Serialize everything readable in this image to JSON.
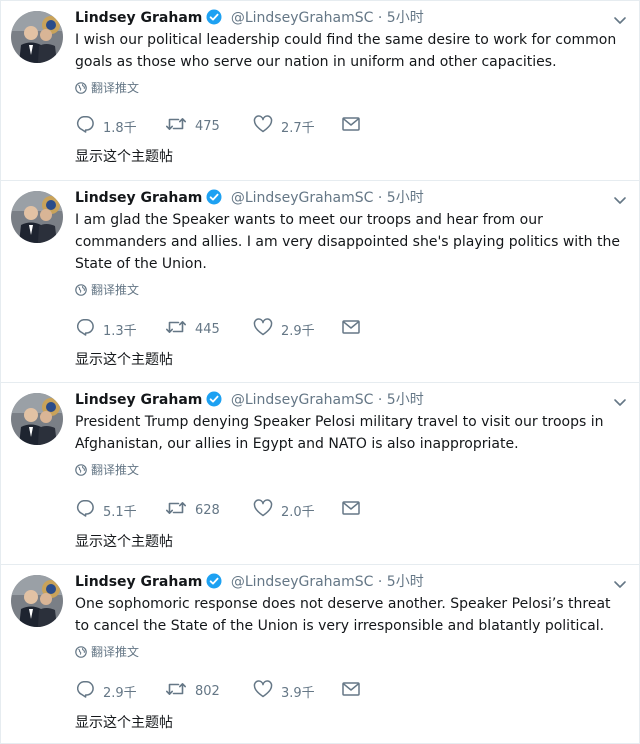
{
  "tweets": [
    {
      "name": "Lindsey Graham",
      "handle": "@LindseyGrahamSC",
      "sep": "·",
      "time": "5小时",
      "text": "I wish our political leadership could find the same desire to work for common goals as those who serve our nation in uniform and other capacities.",
      "translate": "翻译推文",
      "replies": "1.8千",
      "retweets": "475",
      "likes": "2.7千",
      "thread": "显示这个主题帖"
    },
    {
      "name": "Lindsey Graham",
      "handle": "@LindseyGrahamSC",
      "sep": "·",
      "time": "5小时",
      "text": "I am glad the Speaker wants to meet our troops and hear from our commanders and allies. I am very disappointed she's playing politics with the State of the Union.",
      "translate": "翻译推文",
      "replies": "1.3千",
      "retweets": "445",
      "likes": "2.9千",
      "thread": "显示这个主题帖"
    },
    {
      "name": "Lindsey Graham",
      "handle": "@LindseyGrahamSC",
      "sep": "·",
      "time": "5小时",
      "text": "President Trump denying Speaker Pelosi military travel to visit our troops in Afghanistan, our allies in Egypt and NATO is also inappropriate.",
      "translate": "翻译推文",
      "replies": "5.1千",
      "retweets": "628",
      "likes": "2.0千",
      "thread": "显示这个主题帖"
    },
    {
      "name": "Lindsey Graham",
      "handle": "@LindseyGrahamSC",
      "sep": "·",
      "time": "5小时",
      "text": "One sophomoric response does not deserve another. Speaker Pelosi’s threat to cancel the State of the Union is very irresponsible and blatantly political.",
      "translate": "翻译推文",
      "replies": "2.9千",
      "retweets": "802",
      "likes": "3.9千",
      "thread": "显示这个主题帖"
    }
  ],
  "colors": {
    "text": "#14171a",
    "muted": "#657786",
    "verified": "#1da1f2",
    "border": "#e6ecf0"
  },
  "icons": [
    "verified-badge-icon",
    "chevron-down-icon",
    "globe-icon",
    "reply-icon",
    "retweet-icon",
    "like-icon",
    "direct-message-icon"
  ]
}
